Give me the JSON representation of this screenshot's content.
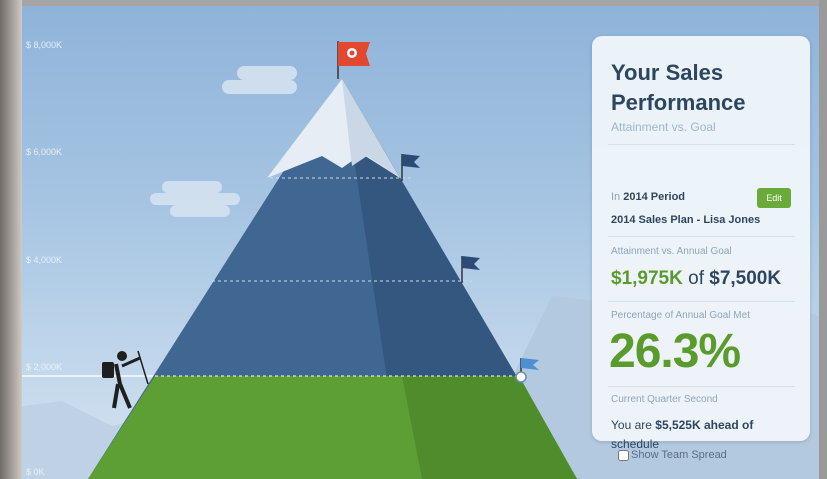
{
  "chart_data": {
    "type": "area",
    "title": "Your Sales Performance",
    "y_ticks": [
      "$ 8,000K",
      "$ 6,000K",
      "$ 4,000K",
      "$ 2,000K",
      "$ 0K"
    ],
    "ylim": [
      0,
      8000
    ],
    "attainment_k": 1975,
    "goal_k": 7500,
    "quota_flags_k": [
      2000,
      4000,
      6000,
      8000
    ]
  },
  "card": {
    "title": "Your Sales Performance",
    "subtitle": "Attainment vs. Goal",
    "period_prefix": "In",
    "period": "2014 Period",
    "edit_label": "Edit",
    "plan": "2014 Sales Plan - Lisa Jones",
    "attainment_label": "Attainment vs. Annual Goal",
    "attainment_value": "$1,975K",
    "attainment_of": "of",
    "goal_value": "$7,500K",
    "pct_label": "Percentage of Annual Goal Met",
    "pct_value": "26.3%",
    "quarter_label_prefix": "Current Quarter",
    "quarter_label_value": "Second",
    "status_prefix": "You are",
    "status_amount": "$5,525K ahead of",
    "status_suffix": "schedule"
  },
  "footer": {
    "show_team_spread": "Show Team Spread"
  },
  "colors": {
    "accent_green": "#5a9c2c",
    "navy": "#2d4660",
    "sky": "#a8c6e3",
    "mountain_blue": "#3e6592"
  }
}
